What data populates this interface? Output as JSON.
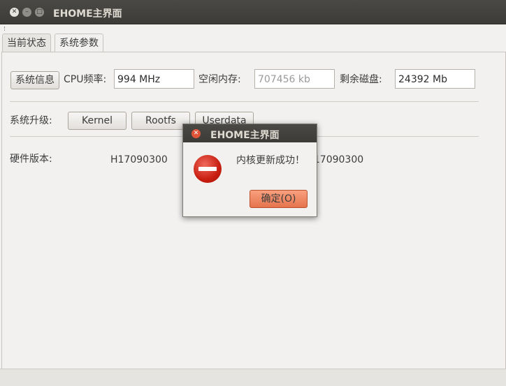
{
  "window": {
    "title": "EHOME主界面"
  },
  "tabs": [
    {
      "label": "当前状态"
    },
    {
      "label": "系统参数"
    }
  ],
  "sysinfo": {
    "button_label": "系统信息",
    "cpu_label": "CPU频率:",
    "cpu_value": "994 MHz",
    "mem_label": "空闲内存:",
    "mem_value": "707456 kb",
    "disk_label": "剩余磁盘:",
    "disk_value": "24392 Mb"
  },
  "upgrade": {
    "label": "系统升级:",
    "kernel": "Kernel",
    "rootfs": "Rootfs",
    "userdata": "Userdata"
  },
  "hardware": {
    "label": "硬件版本:",
    "value": "H17090300",
    "value2": "S17090300"
  },
  "dialog": {
    "title": "EHOME主界面",
    "message": "内核更新成功！",
    "ok_label": "确定(O)"
  }
}
